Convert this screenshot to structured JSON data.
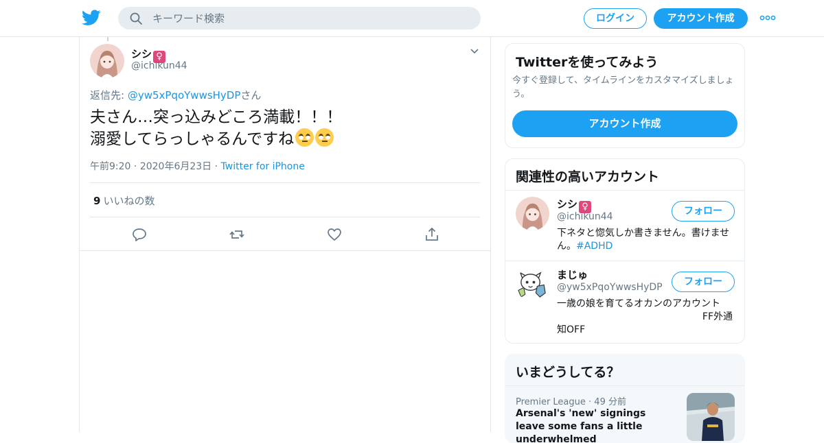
{
  "header": {
    "search_placeholder": "キーワード検索",
    "login_label": "ログイン",
    "signup_label": "アカウント作成"
  },
  "tweet": {
    "author_name": "シシ",
    "author_badge": "♀",
    "author_handle": "@ichikun44",
    "reply_prefix": "返信先: ",
    "reply_handle": "@yw5xPqoYwwsHyDP",
    "reply_suffix": "さん",
    "text_line1": "夫さん…突っ込みどころ満載！！！",
    "text_line2": "溺愛してらっしゃるんですね",
    "emojis": [
      "face-with-rolling-eyes",
      "face-with-rolling-eyes"
    ],
    "time": "午前9:20",
    "date": "2020年6月23日",
    "client": "Twitter for iPhone",
    "like_count": "9",
    "like_label": "いいねの数"
  },
  "sidebar": {
    "signup_card": {
      "title": "Twitterを使ってみよう",
      "description": "今すぐ登録して、タイムラインをカスタマイズしましょう。",
      "button_label": "アカウント作成"
    },
    "related": {
      "title": "関連性の高いアカウント",
      "accounts": [
        {
          "name": "シシ",
          "badge": "♀",
          "handle": "@ichikun44",
          "follow_label": "フォロー",
          "bio_text": "下ネタと惚気しか書きません。書けません。",
          "bio_tag": "#ADHD"
        },
        {
          "name": "まじゅ",
          "handle": "@yw5xPqoYwwsHyDP",
          "follow_label": "フォロー",
          "bio_line1": "一歳の娘を育てるオカンのアカウント",
          "bio_line2": "FF外通",
          "bio_line3": "知OFF"
        }
      ]
    },
    "trends": {
      "title": "いまどうしてる？",
      "item": {
        "category": "Premier League",
        "time": "49 分前",
        "headline": "Arsenal's 'new' signings leave some fans a little underwhelmed"
      }
    }
  },
  "colors": {
    "accent": "#1da1f2",
    "link": "#1b95e0",
    "muted": "#657786",
    "border": "#e1e8ed"
  }
}
